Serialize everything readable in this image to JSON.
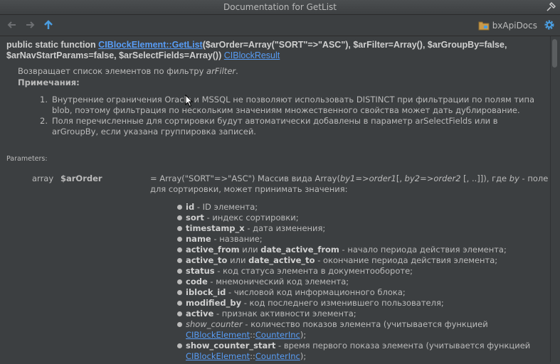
{
  "window": {
    "title": "Documentation for GetList"
  },
  "toolbar": {
    "module_label": "bxApiDocs"
  },
  "signature": {
    "prefix": "public static function ",
    "class_method": "CIBlockElement::GetList",
    "params": "($arOrder=Array(\"SORT\"=>\"ASC\"), $arFilter=Array(), $arGroupBy=false, $arNavStartParams=false, $arSelectFields=Array())",
    "return_type": "CIBlockResult"
  },
  "description": {
    "text": "Возвращает список элементов по фильтру ",
    "filter": "arFilter",
    "end": "."
  },
  "notes_label": "Примечания:",
  "notes": [
    {
      "num": "1.",
      "text": "Внутренние ограничения Oracle и MSSQL не позволяют использовать DISTINCT при фильтрации по полям типа blob, поэтому фильтрация по нескольким значениям множественного свойства может дать дублирование."
    },
    {
      "num": "2.",
      "text": "Поля перечисленные для сортировки будут автоматически добавлены в параметр arSelectFields или в arGroupBy, если указана группировка записей."
    }
  ],
  "params_label": "Parameters:",
  "param": {
    "type": "array",
    "name": "$arOrder",
    "d1": "= Array(\"SORT\"=>\"ASC\") Массив вида Array(",
    "d2": "by1=>order1",
    "d3": "[, ",
    "d4": "by2=>order2",
    "d5": " [, ..]]), где ",
    "d6": "by",
    "d7": " - поле для сортировки, может принимать значения:"
  },
  "fields": [
    {
      "key": "id",
      "desc": " - ID элемента;"
    },
    {
      "key": "sort",
      "desc": " - индекс сортировки;"
    },
    {
      "key": "timestamp_x",
      "desc": " - дата изменения;"
    },
    {
      "key": "name",
      "desc": " - название;"
    },
    {
      "key": "active_from",
      "mid": " или ",
      "key2": "date_active_from",
      "desc": " - начало периода действия элемента;"
    },
    {
      "key": "active_to",
      "mid": " или ",
      "key2": "date_active_to",
      "desc": " - окончание периода действия элемента;"
    },
    {
      "key": "status",
      "desc": " - код статуса элемента в документообороте;"
    },
    {
      "key": "code",
      "desc": " - мнемонический код элемента;"
    },
    {
      "key": "iblock_id",
      "desc": " - числовой код информационного блока;"
    },
    {
      "key": "modified_by",
      "desc": " - код последнего изменившего пользователя;"
    },
    {
      "key": "active",
      "desc": " - признак активности элемента;"
    }
  ],
  "show_counter": {
    "key": "show_counter",
    "desc": " - количество показов элемента (учитывается функцией ",
    "cls": "CIBlockElement",
    "sep": "::",
    "fn": "CounterInc",
    "end": ");"
  },
  "show_counter_start": {
    "key": "show_counter_start",
    "desc": " - время первого показа элемента (учитывается функцией ",
    "cls": "CIBlockElement",
    "sep": "::",
    "fn": "CounterInc",
    "end": ");"
  }
}
